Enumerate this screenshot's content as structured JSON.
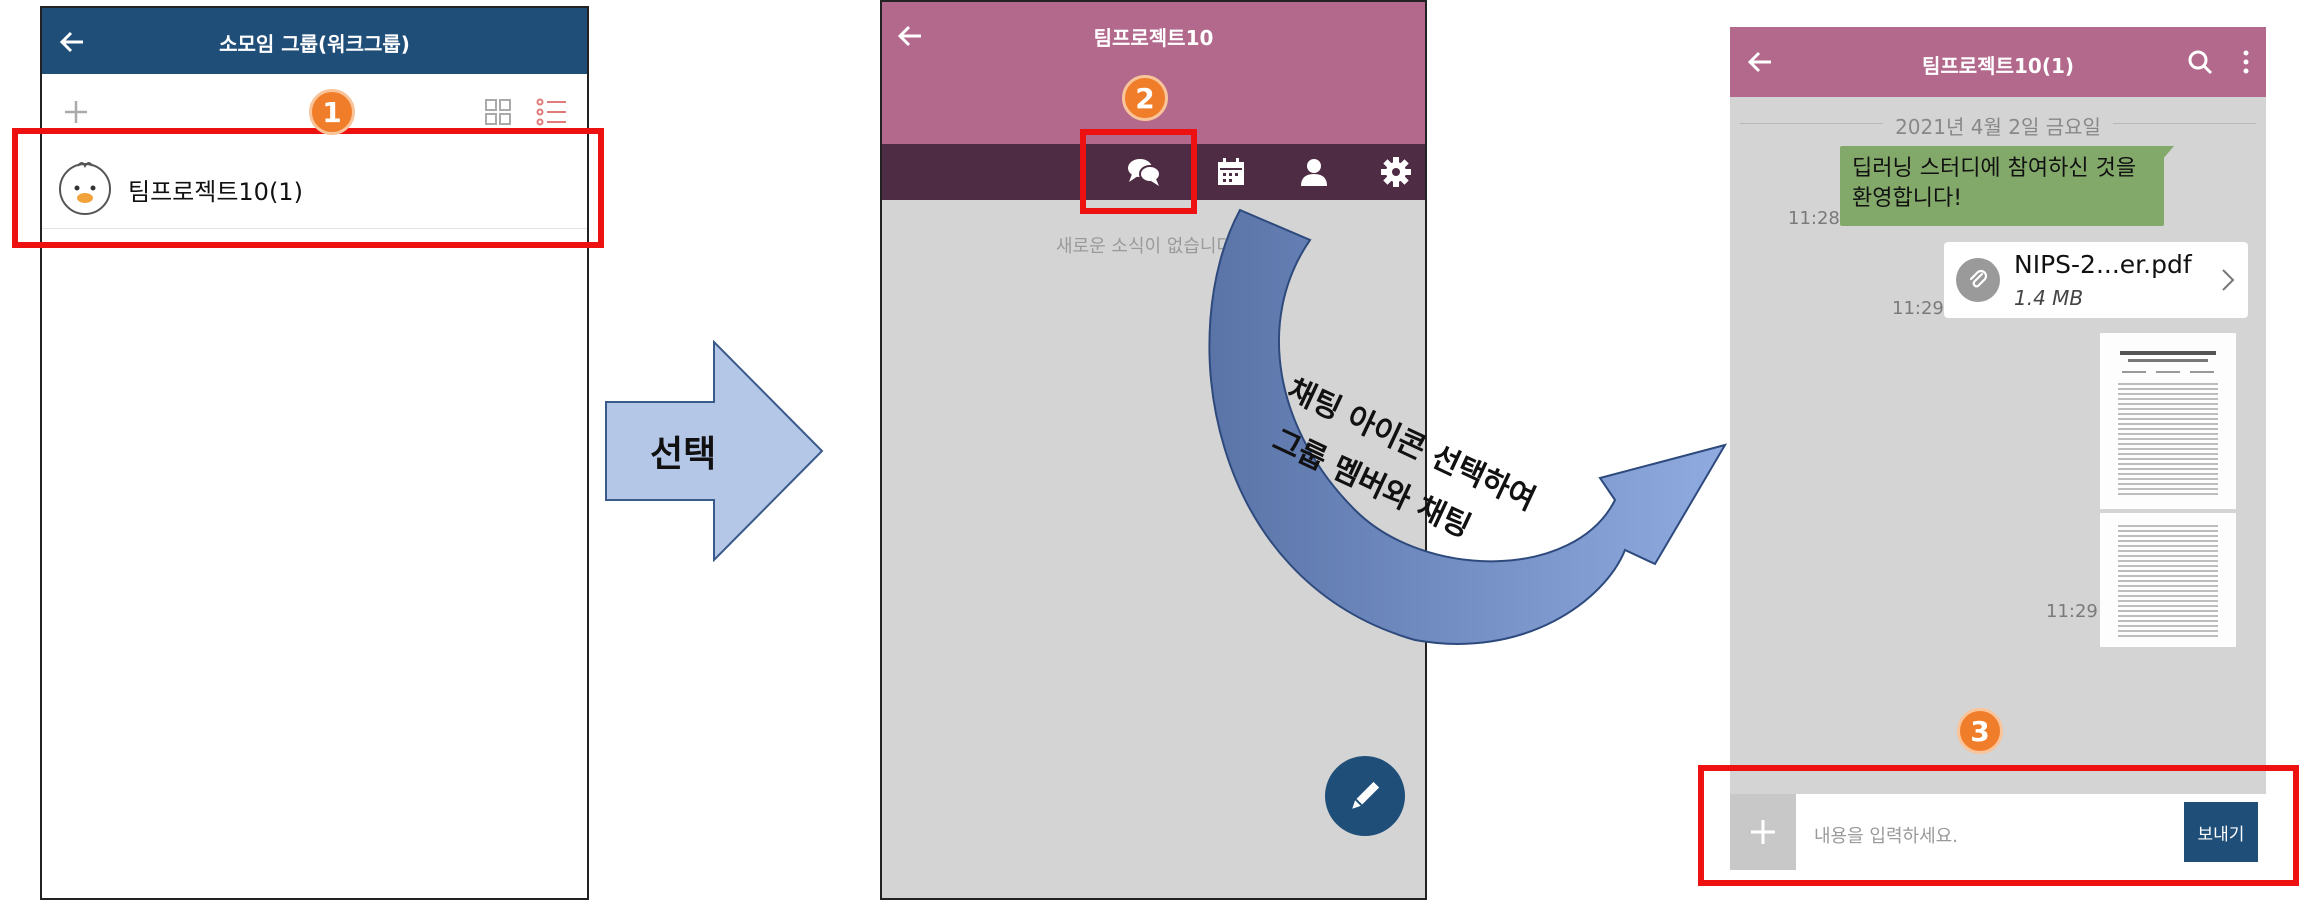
{
  "screen1": {
    "title": "소모임 그룹(워크그룹)",
    "badge": "1",
    "group_name": "팀프로젝트10(1)"
  },
  "arrow1": {
    "label": "선택"
  },
  "screen2": {
    "title": "팀프로젝트10",
    "badge": "2",
    "empty_text": "새로운 소식이 없습니다"
  },
  "arrow2": {
    "line1": "채팅 아이콘 선택하여",
    "line2": "그룹 멤버와 채팅"
  },
  "screen3": {
    "title": "팀프로젝트10(1)",
    "date": "2021년 4월 2일 금요일",
    "message_text": "딥러닝 스터디에 참여하신 것을 환영합니다!",
    "message_time": "11:28",
    "file_name": "NIPS-2...er.pdf",
    "file_size": "1.4 MB",
    "file_time": "11:29",
    "image_time": "11:29",
    "badge": "3",
    "input_placeholder": "내용을 입력하세요.",
    "send_label": "보내기"
  },
  "colors": {
    "navy": "#1f4e79",
    "mauve": "#b2698c",
    "dark_plum": "#4e2c43",
    "chat_bg": "#d4d4d4",
    "bubble_green": "#82a86a",
    "highlight_red": "#ee1111",
    "badge_orange": "#f07d2a",
    "arrow_blue": "#b4c7e7"
  }
}
